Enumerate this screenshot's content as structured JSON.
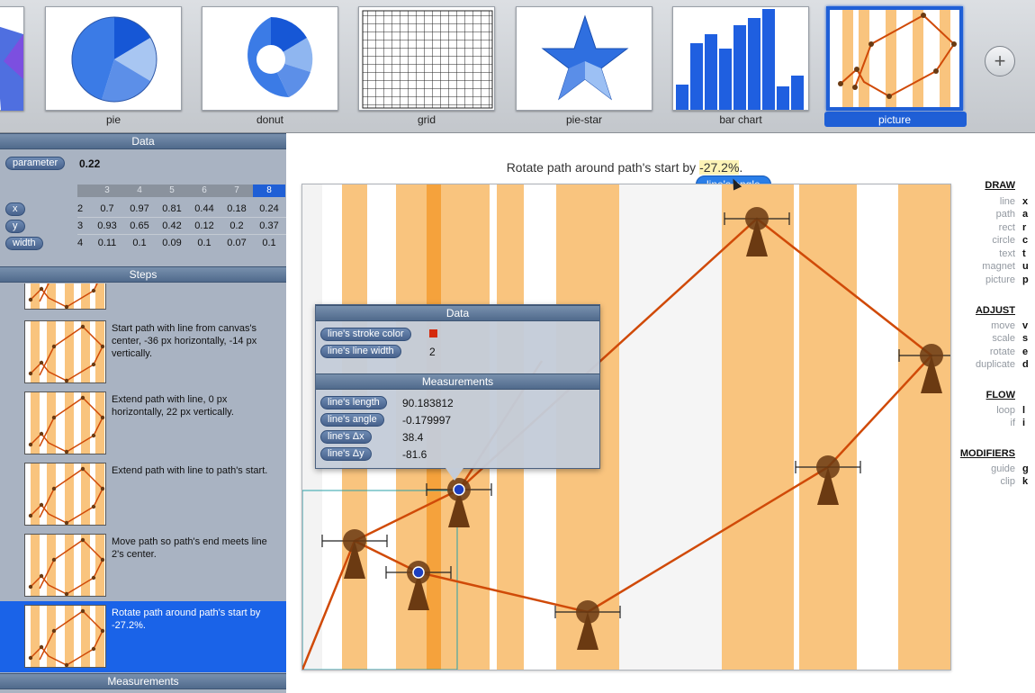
{
  "gallery": {
    "items": [
      {
        "label": ""
      },
      {
        "label": "pie"
      },
      {
        "label": "donut"
      },
      {
        "label": "grid"
      },
      {
        "label": "pie-star"
      },
      {
        "label": "bar chart"
      },
      {
        "label": "picture",
        "selected": true
      }
    ],
    "add_label": "+"
  },
  "data_panel": {
    "title": "Data",
    "parameter_label": "parameter",
    "parameter_value": "0.22",
    "columns": [
      "3",
      "4",
      "5",
      "6",
      "7",
      "8"
    ],
    "active_column": "8",
    "rows": [
      {
        "label": "x",
        "values": [
          "2",
          "0.7",
          "0.97",
          "0.81",
          "0.44",
          "0.18",
          "0.24"
        ]
      },
      {
        "label": "y",
        "values": [
          "3",
          "0.93",
          "0.65",
          "0.42",
          "0.12",
          "0.2",
          "0.37"
        ]
      },
      {
        "label": "width",
        "values": [
          "4",
          "0.11",
          "0.1",
          "0.09",
          "0.1",
          "0.07",
          "0.1"
        ]
      }
    ]
  },
  "steps_panel": {
    "title": "Steps",
    "steps": [
      {
        "text": ""
      },
      {
        "text": "Start path with line from canvas's center, -36 px horizontally, -14 px vertically."
      },
      {
        "text": "Extend path with line, 0 px horizontally, 22 px vertically."
      },
      {
        "text": "Extend path with line to path's start."
      },
      {
        "text": "Move path so path's end meets line 2's center."
      },
      {
        "text": "Rotate path around path's start by -27.2%.",
        "active": true
      }
    ]
  },
  "measurements_panel": {
    "title": "Measurements"
  },
  "canvas": {
    "caption_prefix": "Rotate path around path's start by ",
    "caption_value": "-27.2%",
    "caption_suffix": ".",
    "tooltip": "line's angle"
  },
  "popup": {
    "data_title": "Data",
    "data_rows": [
      {
        "label": "line's stroke color",
        "value": "",
        "swatch": "#d42a0c"
      },
      {
        "label": "line's line width",
        "value": "2"
      }
    ],
    "measure_title": "Measurements",
    "measure_rows": [
      {
        "label": "line's length",
        "value": "90.183812"
      },
      {
        "label": "line's angle",
        "value": "-0.179997"
      },
      {
        "label": "line's Δx",
        "value": "38.4"
      },
      {
        "label": "line's Δy",
        "value": "-81.6"
      }
    ]
  },
  "tools": {
    "draw": {
      "title": "DRAW",
      "items": [
        {
          "label": "line",
          "key": "x"
        },
        {
          "label": "path",
          "key": "a"
        },
        {
          "label": "rect",
          "key": "r"
        },
        {
          "label": "circle",
          "key": "c"
        },
        {
          "label": "text",
          "key": "t"
        },
        {
          "label": "magnet",
          "key": "u"
        },
        {
          "label": "picture",
          "key": "p"
        }
      ]
    },
    "adjust": {
      "title": "ADJUST",
      "items": [
        {
          "label": "move",
          "key": "v"
        },
        {
          "label": "scale",
          "key": "s"
        },
        {
          "label": "rotate",
          "key": "e"
        },
        {
          "label": "duplicate",
          "key": "d"
        }
      ]
    },
    "flow": {
      "title": "FLOW",
      "items": [
        {
          "label": "loop",
          "key": "l"
        },
        {
          "label": "if",
          "key": "i"
        }
      ]
    },
    "modifiers": {
      "title": "MODIFIERS",
      "items": [
        {
          "label": "guide",
          "key": "g"
        },
        {
          "label": "clip",
          "key": "k"
        }
      ]
    }
  },
  "colors": {
    "accent": "#1f5fd6",
    "stripe": "#f9c47e",
    "path": "#d04a08",
    "figure": "#6b3a12"
  }
}
